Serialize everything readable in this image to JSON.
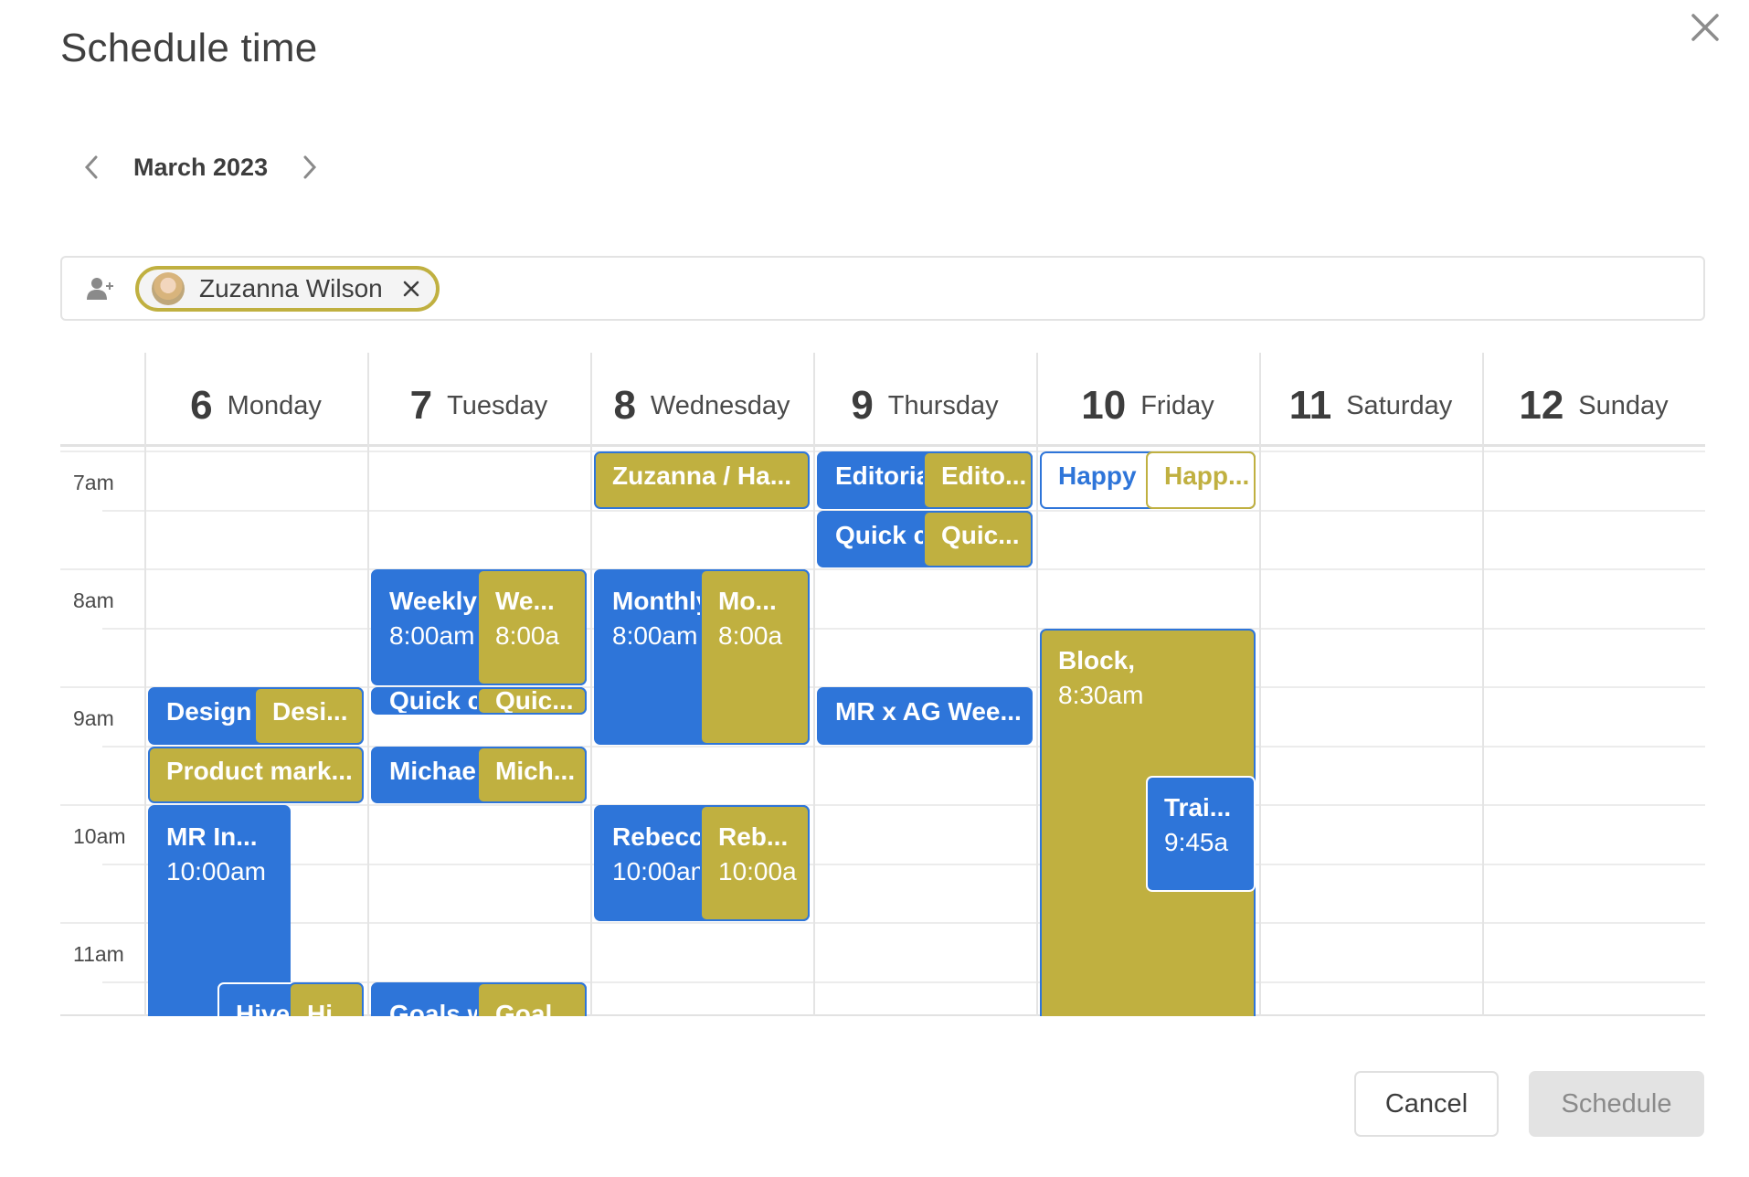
{
  "dialog": {
    "title": "Schedule time",
    "close_icon": "close-icon"
  },
  "month_nav": {
    "label": "March 2023",
    "prev_icon": "chevron-left-icon",
    "next_icon": "chevron-right-icon"
  },
  "attendees": {
    "add_icon": "add-person-icon",
    "chips": [
      {
        "name": "Zuzanna Wilson",
        "remove_icon": "close-icon",
        "color": "#c0b040"
      }
    ]
  },
  "calendar": {
    "days": [
      {
        "num": "6",
        "name": "Monday"
      },
      {
        "num": "7",
        "name": "Tuesday"
      },
      {
        "num": "8",
        "name": "Wednesday"
      },
      {
        "num": "9",
        "name": "Thursday"
      },
      {
        "num": "10",
        "name": "Friday"
      },
      {
        "num": "11",
        "name": "Saturday"
      },
      {
        "num": "12",
        "name": "Sunday"
      }
    ],
    "time_labels": [
      "7am",
      "8am",
      "9am",
      "10am",
      "11am"
    ],
    "colors": {
      "blue": "#2e75d9",
      "gold": "#c0b040"
    },
    "events": [
      {
        "day": 0,
        "title": "Design",
        "time": "",
        "start": 9.0,
        "end": 9.5,
        "style": "blue",
        "col": "full"
      },
      {
        "day": 0,
        "title": "Desi...",
        "time": "",
        "start": 9.0,
        "end": 9.5,
        "style": "gold",
        "col": "right"
      },
      {
        "day": 0,
        "title": "Product mark...",
        "time": "",
        "start": 9.5,
        "end": 10.0,
        "style": "gold",
        "col": "full"
      },
      {
        "day": 0,
        "title": "MR In...",
        "time": "10:00am",
        "start": 10.0,
        "end": 12.5,
        "style": "blue",
        "col": "wide-left"
      },
      {
        "day": 0,
        "title": "Hive...",
        "time": "",
        "start": 11.5,
        "end": 12.5,
        "style": "blue ol",
        "col": "mid-right"
      },
      {
        "day": 0,
        "title": "Hi...",
        "time": "",
        "start": 11.5,
        "end": 12.5,
        "style": "gold",
        "col": "far-right"
      },
      {
        "day": 1,
        "title": "Weekly",
        "time": "8:00am",
        "start": 8.0,
        "end": 9.0,
        "style": "blue",
        "col": "full"
      },
      {
        "day": 1,
        "title": "We...",
        "time": "8:00a",
        "start": 8.0,
        "end": 9.0,
        "style": "gold",
        "col": "right"
      },
      {
        "day": 1,
        "title": "Quick c",
        "time": "",
        "start": 9.0,
        "end": 9.25,
        "style": "blue",
        "col": "full"
      },
      {
        "day": 1,
        "title": "Quic...",
        "time": "",
        "start": 9.0,
        "end": 9.25,
        "style": "gold",
        "col": "right"
      },
      {
        "day": 1,
        "title": "Michae",
        "time": "",
        "start": 9.5,
        "end": 10.0,
        "style": "blue",
        "col": "full"
      },
      {
        "day": 1,
        "title": "Mich...",
        "time": "",
        "start": 9.5,
        "end": 10.0,
        "style": "gold",
        "col": "right"
      },
      {
        "day": 1,
        "title": "Goals w",
        "time": "",
        "start": 11.5,
        "end": 12.5,
        "style": "blue",
        "col": "full"
      },
      {
        "day": 1,
        "title": "Goal...",
        "time": "",
        "start": 11.5,
        "end": 12.5,
        "style": "gold",
        "col": "right"
      },
      {
        "day": 2,
        "title": "Zuzanna / Ha...",
        "time": "",
        "start": 7.0,
        "end": 7.5,
        "style": "gold",
        "col": "full"
      },
      {
        "day": 2,
        "title": "Monthly",
        "time": "8:00am",
        "start": 8.0,
        "end": 9.5,
        "style": "blue",
        "col": "full"
      },
      {
        "day": 2,
        "title": "Mo...",
        "time": "8:00a",
        "start": 8.0,
        "end": 9.5,
        "style": "gold",
        "col": "right"
      },
      {
        "day": 2,
        "title": "Rebecc",
        "time": "10:00am",
        "start": 10.0,
        "end": 11.0,
        "style": "blue",
        "col": "full"
      },
      {
        "day": 2,
        "title": "Reb...",
        "time": "10:00a",
        "start": 10.0,
        "end": 11.0,
        "style": "gold",
        "col": "right"
      },
      {
        "day": 3,
        "title": "Editoria",
        "time": "",
        "start": 7.0,
        "end": 7.5,
        "style": "blue",
        "col": "full"
      },
      {
        "day": 3,
        "title": "Edito...",
        "time": "",
        "start": 7.0,
        "end": 7.5,
        "style": "gold",
        "col": "right"
      },
      {
        "day": 3,
        "title": "Quick c",
        "time": "",
        "start": 7.5,
        "end": 8.0,
        "style": "blue",
        "col": "full"
      },
      {
        "day": 3,
        "title": "Quic...",
        "time": "",
        "start": 7.5,
        "end": 8.0,
        "style": "gold",
        "col": "right"
      },
      {
        "day": 3,
        "title": "MR x AG Wee...",
        "time": "",
        "start": 9.0,
        "end": 9.5,
        "style": "blue",
        "col": "full"
      },
      {
        "day": 4,
        "title": "Happy",
        "time": "",
        "start": 7.0,
        "end": 7.5,
        "style": "wblue",
        "col": "full"
      },
      {
        "day": 4,
        "title": "Happ...",
        "time": "",
        "start": 7.0,
        "end": 7.5,
        "style": "wgold",
        "col": "right"
      },
      {
        "day": 4,
        "title": "Block,",
        "time": "8:30am",
        "start": 8.5,
        "end": 12.5,
        "style": "gold",
        "col": "full"
      },
      {
        "day": 4,
        "title": "Trai...",
        "time": "9:45a",
        "start": 9.75,
        "end": 10.75,
        "style": "blue ol",
        "col": "right"
      }
    ]
  },
  "footer": {
    "cancel_label": "Cancel",
    "schedule_label": "Schedule"
  }
}
